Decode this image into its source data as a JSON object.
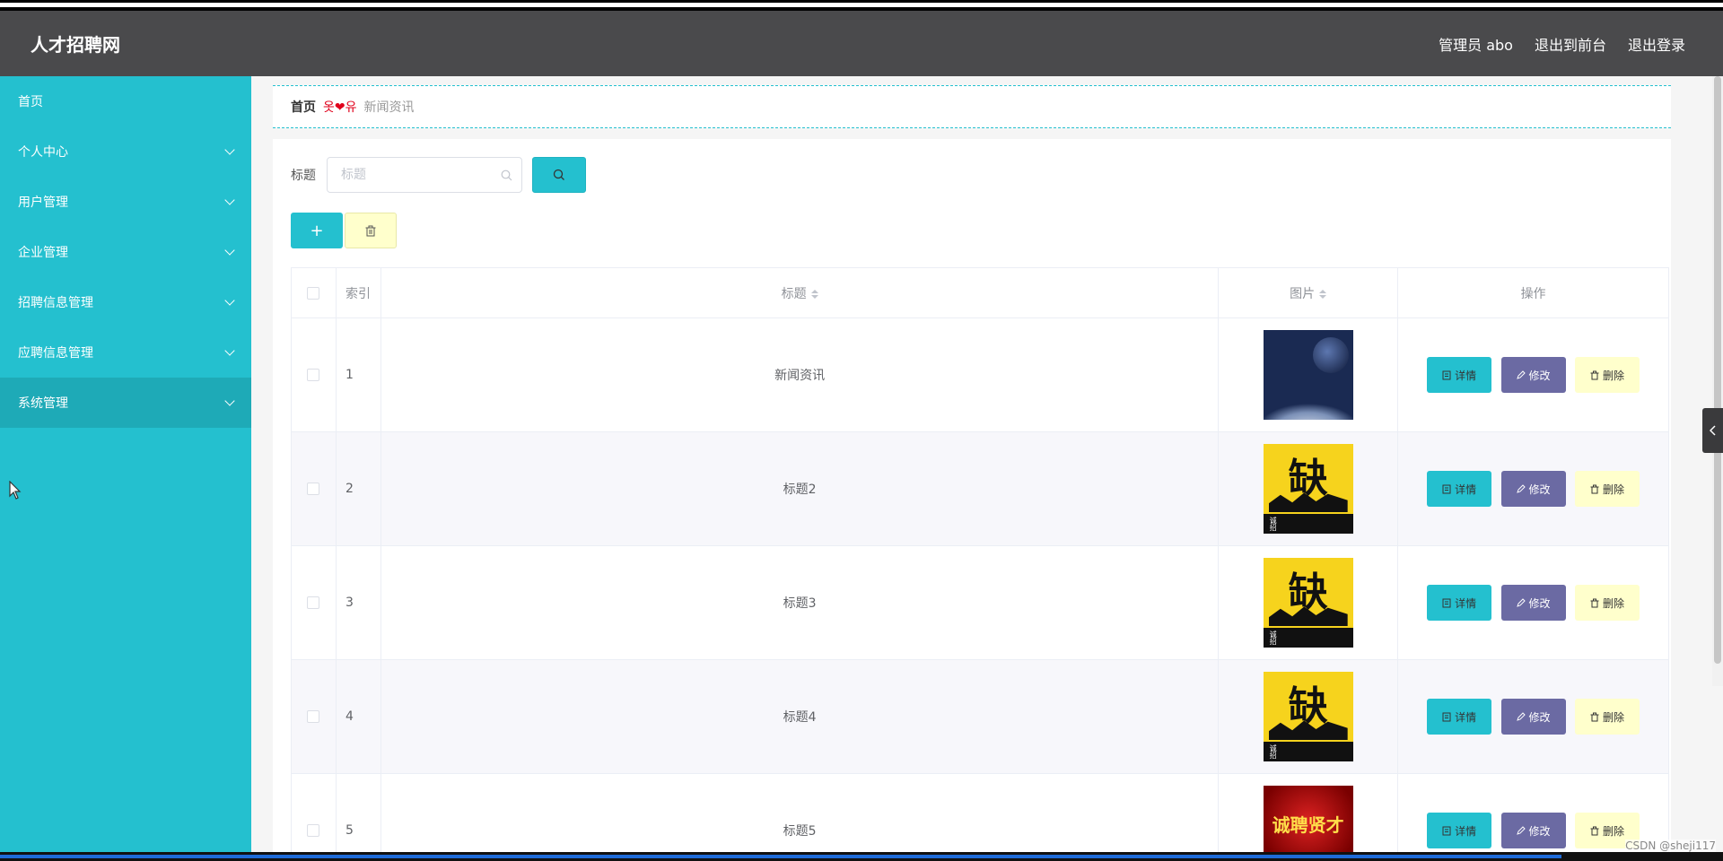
{
  "app": {
    "title": "人才招聘网"
  },
  "header": {
    "admin_label": "管理员 abo",
    "to_frontend": "退出到前台",
    "logout": "退出登录"
  },
  "sidebar": {
    "items": [
      {
        "label": "首页",
        "has_children": false
      },
      {
        "label": "个人中心",
        "has_children": true
      },
      {
        "label": "用户管理",
        "has_children": true
      },
      {
        "label": "企业管理",
        "has_children": true
      },
      {
        "label": "招聘信息管理",
        "has_children": true
      },
      {
        "label": "应聘信息管理",
        "has_children": true
      },
      {
        "label": "系统管理",
        "has_children": true,
        "active": true
      }
    ]
  },
  "breadcrumb": {
    "home": "首页",
    "separator": "옷❤유",
    "current": "新闻资讯"
  },
  "search": {
    "label": "标题",
    "placeholder": "标题"
  },
  "actions": {
    "add_symbol": "+",
    "delete_icon": "trash-icon"
  },
  "table": {
    "headers": [
      "",
      "索引",
      "标题",
      "图片",
      "操作"
    ],
    "rows": [
      {
        "index": "1",
        "title": "新闻资讯",
        "image": "space-planet-image"
      },
      {
        "index": "2",
        "title": "标题2",
        "image": "yellow-recruit-poster-image"
      },
      {
        "index": "3",
        "title": "标题3",
        "image": "yellow-recruit-poster-image"
      },
      {
        "index": "4",
        "title": "标题4",
        "image": "yellow-recruit-poster-image"
      },
      {
        "index": "5",
        "title": "标题5",
        "image": "red-recruit-banner-image"
      }
    ],
    "ops": {
      "detail": "详情",
      "edit": "修改",
      "delete": "删除"
    },
    "poster_text": {
      "big": "缺",
      "small": "诚招",
      "red": "诚聘贤才"
    }
  },
  "watermark": "CSDN @sheji117",
  "colors": {
    "sidebar": "#24c0cf",
    "header": "#4a4a4c",
    "edit_button": "#6b6aa3",
    "delete_button": "#ffffcc"
  }
}
